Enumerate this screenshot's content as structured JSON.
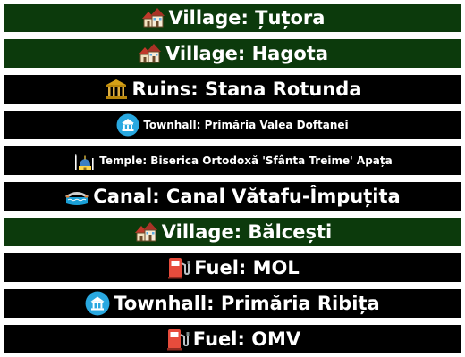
{
  "rows": [
    {
      "category": "Village",
      "icon": "village-icon",
      "label": "Village: Țuțora",
      "style": "green"
    },
    {
      "category": "Village",
      "icon": "village-icon",
      "label": "Village: Hagota",
      "style": "green"
    },
    {
      "category": "Ruins",
      "icon": "ruins-icon",
      "label": "Ruins: Stana Rotunda",
      "style": "dark"
    },
    {
      "category": "Townhall",
      "icon": "townhall-icon",
      "label": "Townhall: Primăria Valea Doftanei",
      "style": "dark"
    },
    {
      "category": "Temple",
      "icon": "temple-icon",
      "label": "Temple: Biserica Ortodoxă 'Sfânta Treime' Apața",
      "style": "dark"
    },
    {
      "category": "Canal",
      "icon": "canal-icon",
      "label": "Canal: Canal Vătafu-Împuțita",
      "style": "dark"
    },
    {
      "category": "Village",
      "icon": "village-icon",
      "label": "Village: Bălcești",
      "style": "green"
    },
    {
      "category": "Fuel",
      "icon": "fuel-icon",
      "label": "Fuel: MOL",
      "style": "dark"
    },
    {
      "category": "Townhall",
      "icon": "townhall-icon",
      "label": "Townhall: Primăria Ribița",
      "style": "dark"
    },
    {
      "category": "Fuel",
      "icon": "fuel-icon",
      "label": "Fuel: OMV",
      "style": "dark"
    }
  ],
  "colors": {
    "row_dark": "#000000",
    "row_green": "#0c3a0c",
    "text": "#ffffff"
  }
}
